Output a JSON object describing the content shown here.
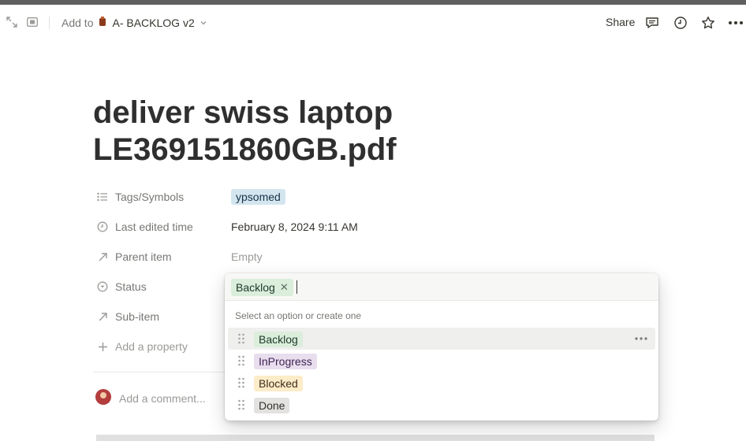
{
  "header": {
    "add_to_label": "Add to",
    "database_name": "A- BACKLOG v2",
    "share_label": "Share",
    "icons": [
      "expand-icon",
      "side-peek-icon",
      "database-icon",
      "chevron-down-icon",
      "comment-icon",
      "clock-icon",
      "star-icon",
      "more-icon"
    ]
  },
  "page": {
    "title": "deliver swiss laptop LE369151860GB.pdf"
  },
  "properties": [
    {
      "label": "Tags/Symbols",
      "icon": "list-icon"
    },
    {
      "label": "Last edited time",
      "icon": "clock-icon"
    },
    {
      "label": "Parent item",
      "icon": "relation-arrow-icon"
    },
    {
      "label": "Status",
      "icon": "status-icon"
    },
    {
      "label": "Sub-item",
      "icon": "relation-arrow-icon"
    }
  ],
  "values": {
    "tags": "ypsomed",
    "last_edited": "February 8, 2024 9:11 AM",
    "parent_item": "Empty"
  },
  "add_property_label": "Add a property",
  "comment_placeholder": "Add a comment...",
  "status_popup": {
    "selected": "Backlog",
    "hint": "Select an option or create one",
    "options": [
      {
        "label": "Backlog",
        "bg": "#dbeddb",
        "fg": "#1c3829"
      },
      {
        "label": "InProgress",
        "bg": "#e8deee",
        "fg": "#412454"
      },
      {
        "label": "Blocked",
        "bg": "#fdecc8",
        "fg": "#402c1b"
      },
      {
        "label": "Done",
        "bg": "#e3e2e0",
        "fg": "#32302c"
      }
    ]
  },
  "colors": {
    "tag_blue_bg": "#d3e5ef",
    "tag_blue_fg": "#183347",
    "text_primary": "#37352f",
    "text_secondary": "#787774"
  }
}
